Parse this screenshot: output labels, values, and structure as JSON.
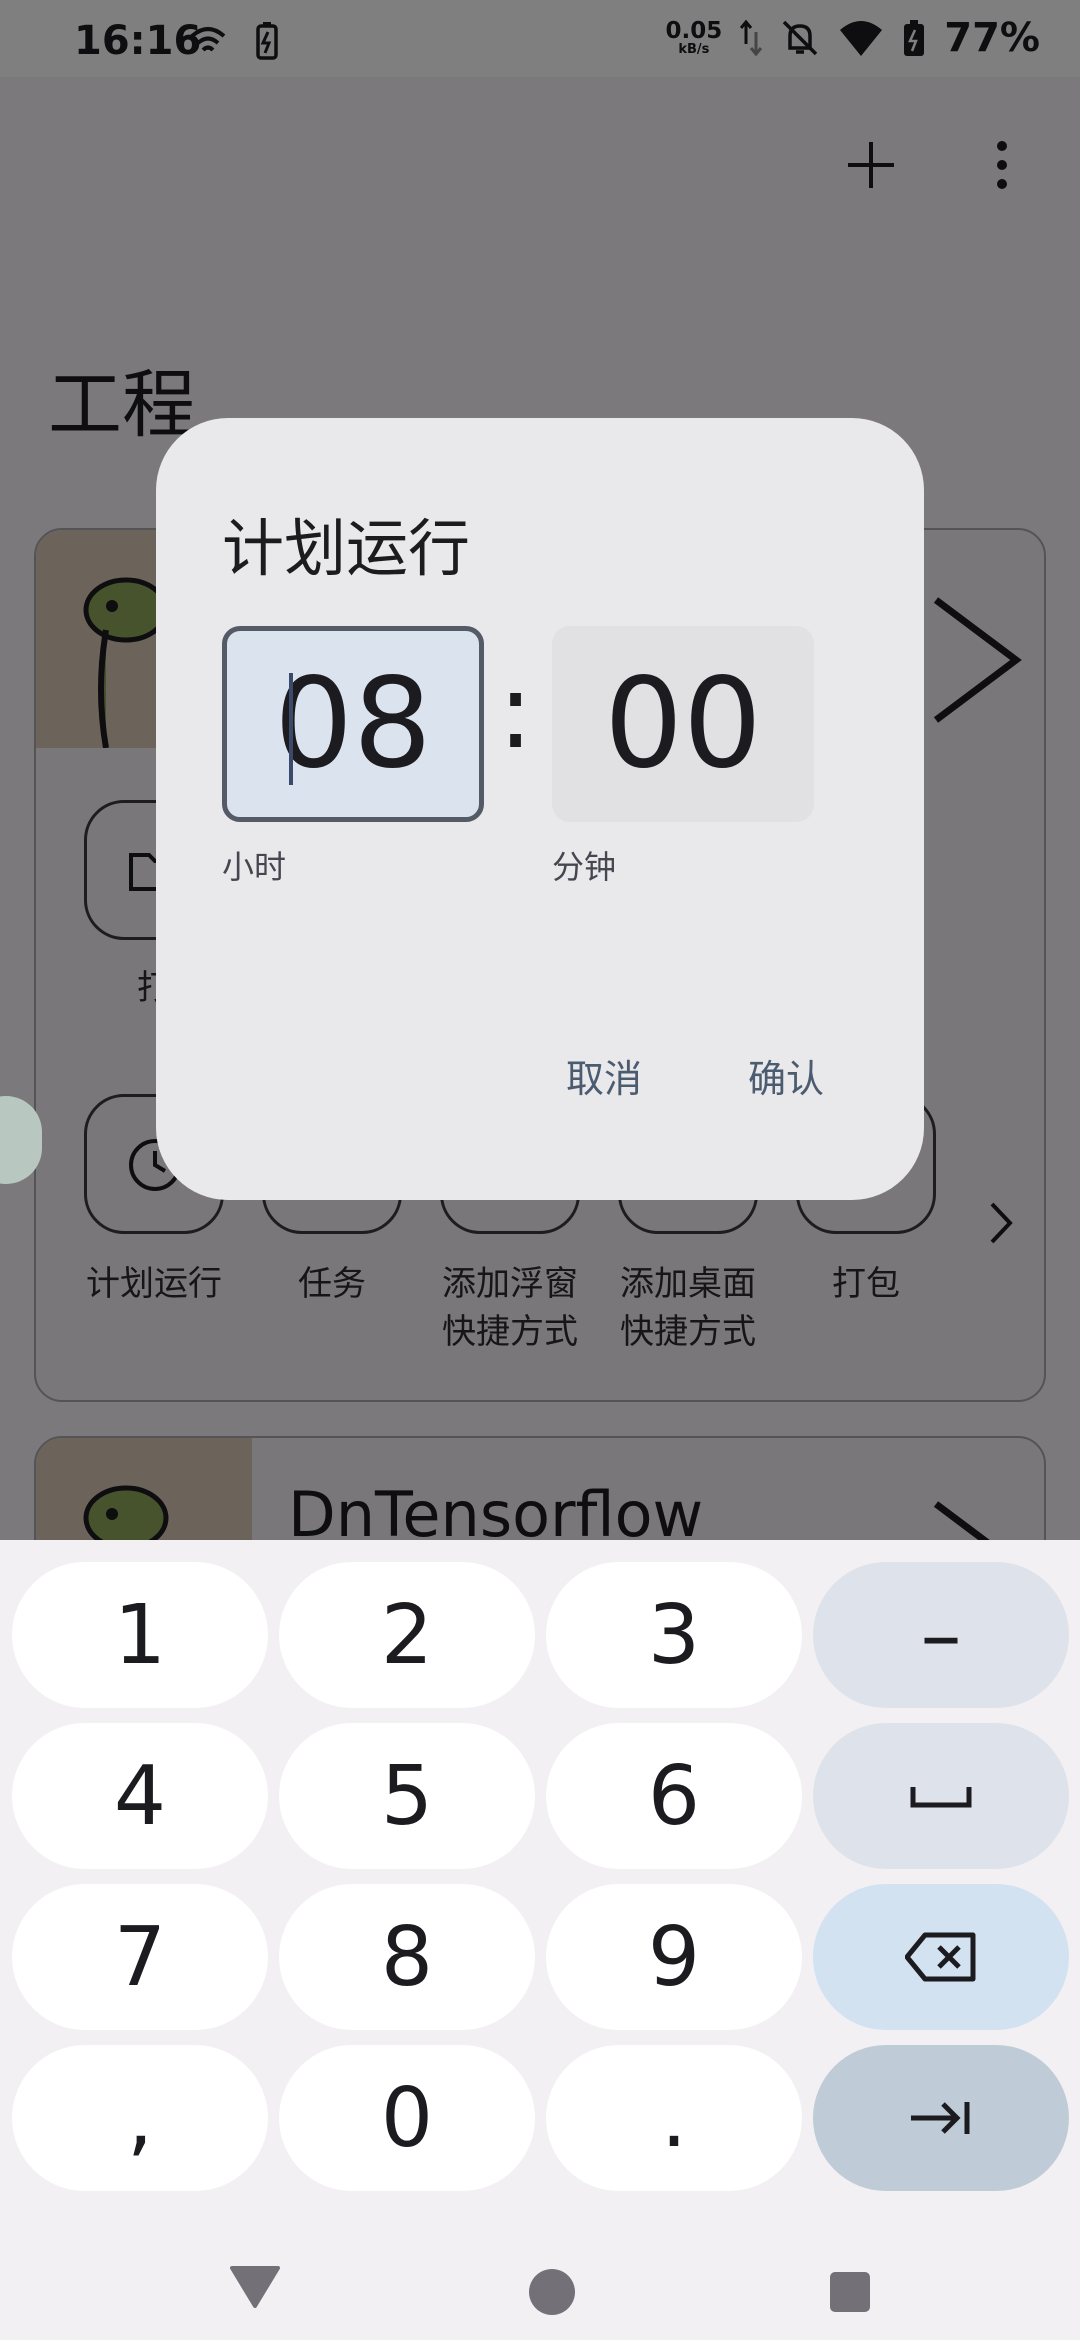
{
  "status_bar": {
    "time": "16:16",
    "net_speed_value": "0.05",
    "net_speed_unit": "kB/s",
    "battery": "77%"
  },
  "page": {
    "title": "工程",
    "add_icon": "plus-icon",
    "menu_icon": "more-vert-icon"
  },
  "card1": {
    "actions_row1": [
      "打开"
    ],
    "actions_row2": [
      {
        "label": "计划运行",
        "icon": "clock-icon"
      },
      {
        "label": "任务",
        "icon": "task-icon"
      },
      {
        "label": "添加浮窗\n快捷方式",
        "icon": "float-window-icon"
      },
      {
        "label": "添加桌面\n快捷方式",
        "icon": "desktop-shortcut-icon"
      },
      {
        "label": "打包",
        "icon": "package-icon"
      }
    ],
    "label_open": "打",
    "label_schedule": "计划运行",
    "label_task": "任务",
    "label_float_1": "添加浮窗",
    "label_float_2": "快捷方式",
    "label_desktop_1": "添加桌面",
    "label_desktop_2": "快捷方式",
    "label_pack": "打包"
  },
  "card2": {
    "title": "DnTensorflow"
  },
  "dialog": {
    "title": "计划运行",
    "hour_value": "08",
    "minute_value": "00",
    "separator": ":",
    "hour_label": "小时",
    "minute_label": "分钟",
    "cancel_label": "取消",
    "confirm_label": "确认"
  },
  "keyboard": {
    "row1": [
      "1",
      "2",
      "3",
      "–"
    ],
    "row2": [
      "4",
      "5",
      "6",
      "␣"
    ],
    "row3": [
      "7",
      "8",
      "9",
      "⌫"
    ],
    "row4": [
      ",",
      "0",
      ".",
      "⇥"
    ],
    "k1": "1",
    "k2": "2",
    "k3": "3",
    "kminus": "–",
    "k4": "4",
    "k5": "5",
    "k6": "6",
    "k7": "7",
    "k8": "8",
    "k9": "9",
    "kcomma": ",",
    "k0": "0",
    "kdot": "."
  },
  "colors": {
    "accent_outline": "#545b66",
    "hour_box_bg": "#dbe4ee",
    "dialog_bg": "#e9e8ea",
    "button_text": "#4b5c70"
  }
}
